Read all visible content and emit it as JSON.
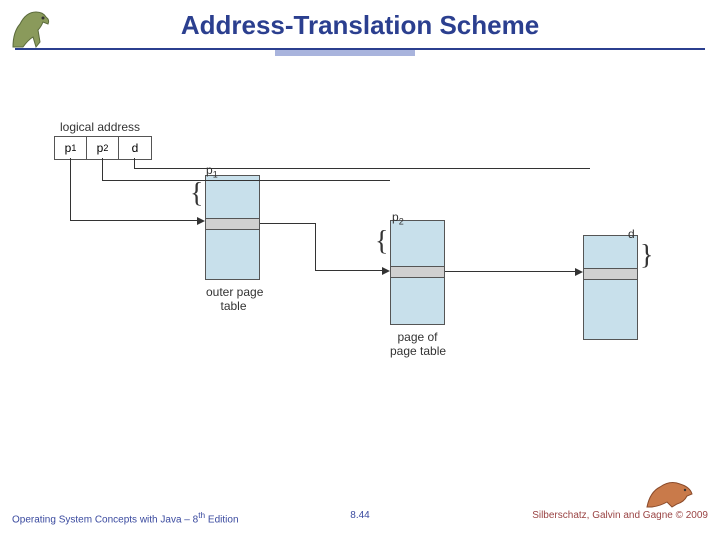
{
  "title": "Address-Translation Scheme",
  "diagram": {
    "logical_address_label": "logical address",
    "p1": "p",
    "p1_sub": "1",
    "p2": "p",
    "p2_sub": "2",
    "d": "d",
    "outer_label": "outer page\ntable",
    "page_of_label": "page of\npage table",
    "brace_p1": "p",
    "brace_p1_sub": "1",
    "brace_p2": "p",
    "brace_p2_sub": "2",
    "brace_d": "d"
  },
  "footer": {
    "left_a": "Operating System Concepts with Java – 8",
    "left_sup": "th",
    "left_b": " Edition",
    "mid": "8.44",
    "right": "Silberschatz, Galvin and Gagne © 2009"
  },
  "icons": {
    "dino_top": "dinosaur-icon",
    "dino_bottom": "dinosaur-icon"
  }
}
